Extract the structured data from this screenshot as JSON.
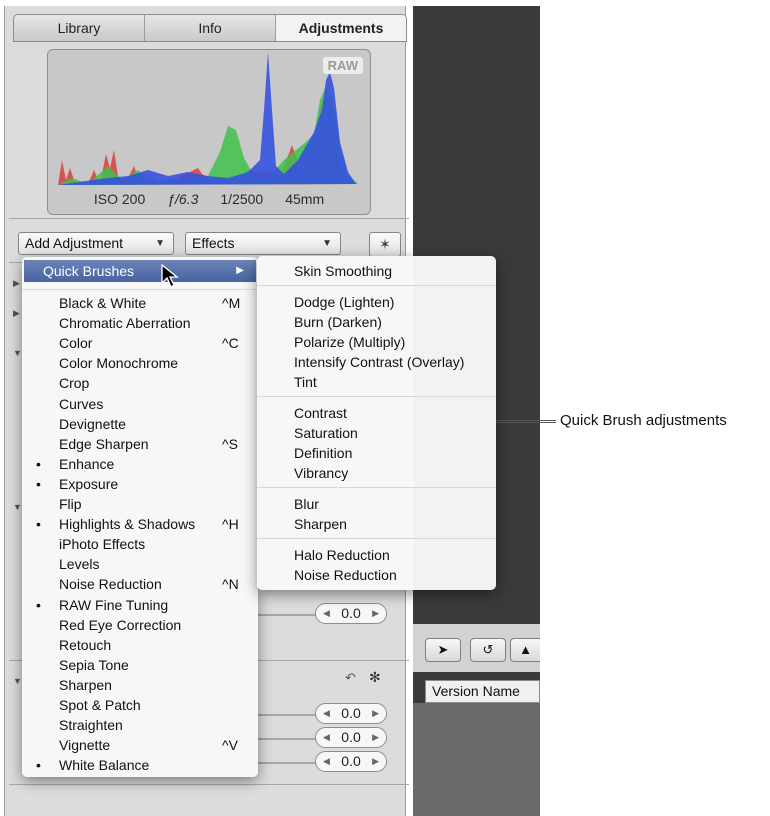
{
  "tabs": [
    "Library",
    "Info",
    "Adjustments"
  ],
  "histogram": {
    "badge": "RAW",
    "iso": "ISO 200",
    "aperture": "ƒ/6.3",
    "shutter": "1/2500",
    "focal": "45mm"
  },
  "controls": {
    "add_adjustment": "Add Adjustment",
    "effects": "Effects"
  },
  "faint_bg": {
    "rows": [
      "0.0",
      "0.0",
      "0.0"
    ]
  },
  "main_menu": {
    "quick_brushes": "Quick Brushes",
    "items": [
      {
        "bullet": "",
        "label": "Black & White",
        "shortcut": "^M"
      },
      {
        "bullet": "",
        "label": "Chromatic Aberration",
        "shortcut": ""
      },
      {
        "bullet": "",
        "label": "Color",
        "shortcut": "^C"
      },
      {
        "bullet": "",
        "label": "Color Monochrome",
        "shortcut": ""
      },
      {
        "bullet": "",
        "label": "Crop",
        "shortcut": ""
      },
      {
        "bullet": "",
        "label": "Curves",
        "shortcut": ""
      },
      {
        "bullet": "",
        "label": "Devignette",
        "shortcut": ""
      },
      {
        "bullet": "",
        "label": "Edge Sharpen",
        "shortcut": "^S"
      },
      {
        "bullet": "•",
        "label": "Enhance",
        "shortcut": ""
      },
      {
        "bullet": "•",
        "label": "Exposure",
        "shortcut": ""
      },
      {
        "bullet": "",
        "label": "Flip",
        "shortcut": ""
      },
      {
        "bullet": "•",
        "label": "Highlights & Shadows",
        "shortcut": "^H"
      },
      {
        "bullet": "",
        "label": "iPhoto Effects",
        "shortcut": ""
      },
      {
        "bullet": "",
        "label": "Levels",
        "shortcut": ""
      },
      {
        "bullet": "",
        "label": "Noise Reduction",
        "shortcut": "^N"
      },
      {
        "bullet": "•",
        "label": "RAW Fine Tuning",
        "shortcut": ""
      },
      {
        "bullet": "",
        "label": "Red Eye Correction",
        "shortcut": ""
      },
      {
        "bullet": "",
        "label": "Retouch",
        "shortcut": ""
      },
      {
        "bullet": "",
        "label": "Sepia Tone",
        "shortcut": ""
      },
      {
        "bullet": "",
        "label": "Sharpen",
        "shortcut": ""
      },
      {
        "bullet": "",
        "label": "Spot & Patch",
        "shortcut": ""
      },
      {
        "bullet": "",
        "label": "Straighten",
        "shortcut": ""
      },
      {
        "bullet": "",
        "label": "Vignette",
        "shortcut": "^V"
      },
      {
        "bullet": "•",
        "label": "White Balance",
        "shortcut": ""
      }
    ]
  },
  "sub_menu": {
    "groups": [
      [
        "Skin Smoothing"
      ],
      [
        "Dodge (Lighten)",
        "Burn (Darken)",
        "Polarize (Multiply)",
        "Intensify Contrast (Overlay)",
        "Tint"
      ],
      [
        "Contrast",
        "Saturation",
        "Definition",
        "Vibrancy"
      ],
      [
        "Blur",
        "Sharpen"
      ],
      [
        "Halo Reduction",
        "Noise Reduction"
      ]
    ]
  },
  "steppers": [
    "0.0",
    "0.0",
    "0.0",
    "0.0"
  ],
  "viewer": {
    "version_name": "Version Name"
  },
  "callout": "Quick Brush adjustments",
  "colors": {
    "highlight": "#4f6aa8",
    "viewer_bg": "#3a3a3a",
    "panel_bg": "#dcdcdc"
  }
}
